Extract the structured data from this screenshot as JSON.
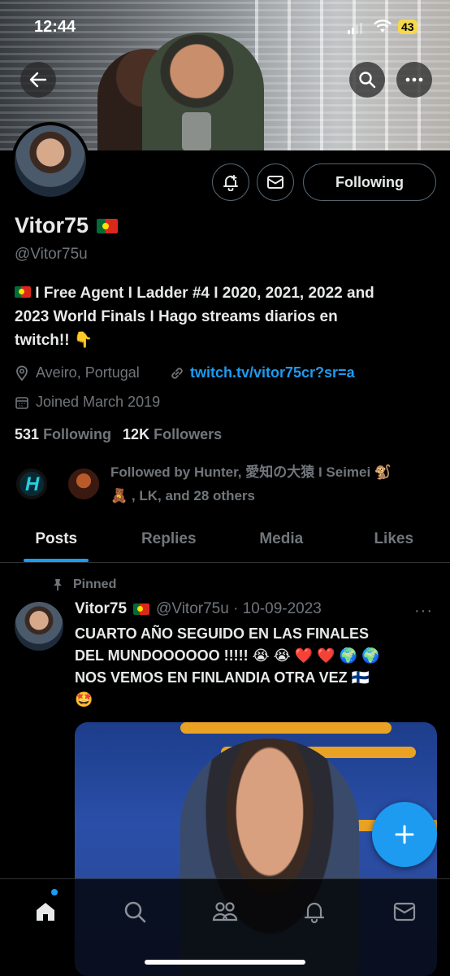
{
  "status_bar": {
    "time": "12:44",
    "battery": "43"
  },
  "profile": {
    "name": "Vitor75",
    "handle": "@Vitor75u",
    "bio_line1": "I Free Agent I Ladder #4 I 2020, 2021, 2022 and",
    "bio_line2": "2023 World Finals I Hago streams diarios en",
    "bio_line3": "twitch!!",
    "bio_emoji_point": "👇",
    "location": "Aveiro, Portugal",
    "link": "twitch.tv/vitor75cr?sr=a",
    "joined": "Joined March 2019",
    "following_count": "531",
    "following_label": "Following",
    "followers_count": "12K",
    "followers_label": "Followers",
    "followed_by_line1": "Followed by Hunter, 愛知の大猿 I Seimei 🐒",
    "followed_by_line2": "🧸 , LK, and 28 others"
  },
  "actions": {
    "follow_label": "Following"
  },
  "tabs": [
    {
      "label": "Posts",
      "active": true
    },
    {
      "label": "Replies",
      "active": false
    },
    {
      "label": "Media",
      "active": false
    },
    {
      "label": "Likes",
      "active": false
    }
  ],
  "pinned_post": {
    "pinned_label": "Pinned",
    "author_name": "Vitor75",
    "author_handle_date": "@Vitor75u · 10-09-2023",
    "more": "···",
    "text_line1": "CUARTO AÑO SEGUIDO EN LAS FINALES",
    "text_line2": "DEL MUNDOOOOOO !!!!! 😭 😭 ❤️ ❤️ 🌍 🌍",
    "text_line3": "NOS VEMOS EN FINLANDIA OTRA VEZ 🇫🇮",
    "text_line4": "🤩"
  },
  "icons": {
    "back": "arrow-left-icon",
    "search": "search-icon",
    "more": "more-icon",
    "bell": "bell-plus-icon",
    "mail": "mail-icon",
    "pin": "pin-icon",
    "location": "location-pin-icon",
    "link": "link-icon",
    "calendar": "calendar-icon",
    "compose": "plus-icon",
    "home": "home-icon",
    "explore": "search-icon",
    "communities": "people-icon",
    "notifications": "bell-icon",
    "messages": "mail-icon"
  },
  "colors": {
    "accent": "#1d9bf0",
    "muted": "#71767b",
    "text": "#e7e9ea",
    "bg": "#000000"
  }
}
